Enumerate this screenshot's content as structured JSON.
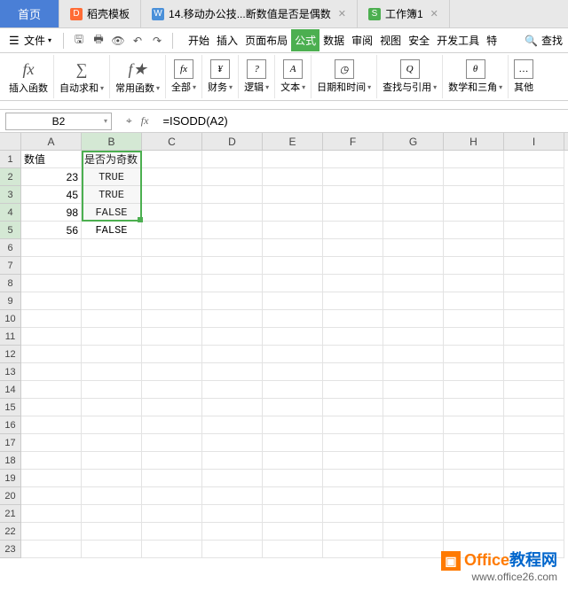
{
  "tabs": {
    "home": "首页",
    "items": [
      {
        "icon": "D",
        "label": "稻壳模板"
      },
      {
        "icon": "W",
        "label": "14.移动办公技...断数值是否是偶数"
      },
      {
        "icon": "S",
        "label": "工作簿1"
      }
    ]
  },
  "toolbar": {
    "file_label": "文件",
    "menu": [
      "开始",
      "插入",
      "页面布局",
      "公式",
      "数据",
      "审阅",
      "视图",
      "安全",
      "开发工具",
      "特"
    ],
    "active_menu": "公式",
    "search_label": "查找"
  },
  "ribbon": [
    {
      "icon": "fx",
      "label": "插入函数"
    },
    {
      "icon": "Σ",
      "label": "自动求和",
      "dd": true
    },
    {
      "icon": "fx★",
      "label": "常用函数",
      "dd": true
    },
    {
      "icon": "fx",
      "label": "全部",
      "dd": true,
      "box": true
    },
    {
      "icon": "¥",
      "label": "财务",
      "dd": true,
      "box": true
    },
    {
      "icon": "?",
      "label": "逻辑",
      "dd": true,
      "box": true
    },
    {
      "icon": "A",
      "label": "文本",
      "dd": true,
      "box": true
    },
    {
      "icon": "⌚",
      "label": "日期和时间",
      "dd": true,
      "box": true
    },
    {
      "icon": "🔍",
      "label": "查找与引用",
      "dd": true,
      "box": true
    },
    {
      "icon": "θ",
      "label": "数学和三角",
      "dd": true,
      "box": true
    },
    {
      "icon": "…",
      "label": "其他"
    }
  ],
  "formula_bar": {
    "cell_ref": "B2",
    "formula": "=ISODD(A2)"
  },
  "sheet": {
    "columns": [
      "A",
      "B",
      "C",
      "D",
      "E",
      "F",
      "G",
      "H",
      "I"
    ],
    "row_count": 23,
    "headers": {
      "A1": "数值",
      "B1": "是否为奇数"
    },
    "data": [
      {
        "a": "23",
        "b": "TRUE"
      },
      {
        "a": "45",
        "b": "TRUE"
      },
      {
        "a": "98",
        "b": "FALSE"
      },
      {
        "a": "56",
        "b": "FALSE"
      }
    ],
    "selected_col": "B",
    "selected_rows": [
      2,
      3,
      4,
      5
    ]
  },
  "watermark": {
    "line1a": "Office",
    "line1b": "教程网",
    "line2": "www.office26.com"
  }
}
